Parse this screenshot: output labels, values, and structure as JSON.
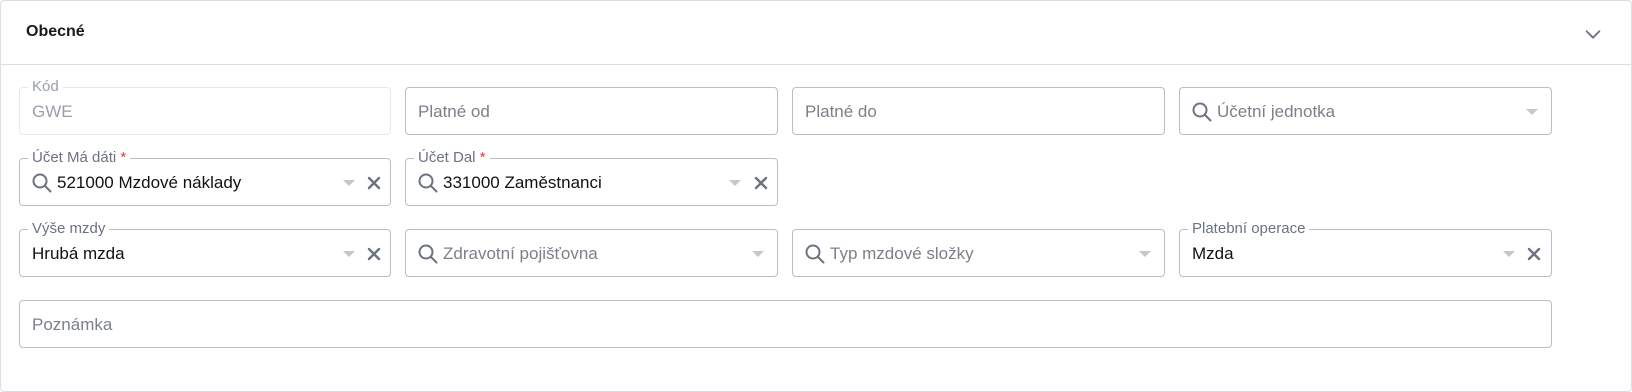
{
  "section": {
    "title": "Obecné"
  },
  "fields": {
    "kod": {
      "label": "Kód",
      "value": "GWE"
    },
    "platne_od": {
      "placeholder": "Platné od"
    },
    "platne_do": {
      "placeholder": "Platné do"
    },
    "ucetni_jednotka": {
      "placeholder": "Účetní jednotka"
    },
    "ucet_ma_dati": {
      "label": "Účet Má dáti",
      "required_mark": "*",
      "value": "521000 Mzdové náklady"
    },
    "ucet_dal": {
      "label": "Účet Dal",
      "required_mark": "*",
      "value": "331000 Zaměstnanci"
    },
    "vyse_mzdy": {
      "label": "Výše mzdy",
      "value": "Hrubá mzda"
    },
    "zdravotni_pojistovna": {
      "placeholder": "Zdravotní pojišťovna"
    },
    "typ_mzdove_slozky": {
      "placeholder": "Typ mzdové složky"
    },
    "platebni_operace": {
      "label": "Platební operace",
      "value": "Mzda"
    },
    "poznamka": {
      "placeholder": "Poznámka"
    }
  },
  "icons": {
    "expand": "chevron-down-icon",
    "search": "search-icon",
    "dropdown": "caret-down-icon",
    "clear": "close-icon"
  },
  "colors": {
    "required": "#e53935",
    "border": "#b9bec7",
    "icon": "#6b7280"
  }
}
